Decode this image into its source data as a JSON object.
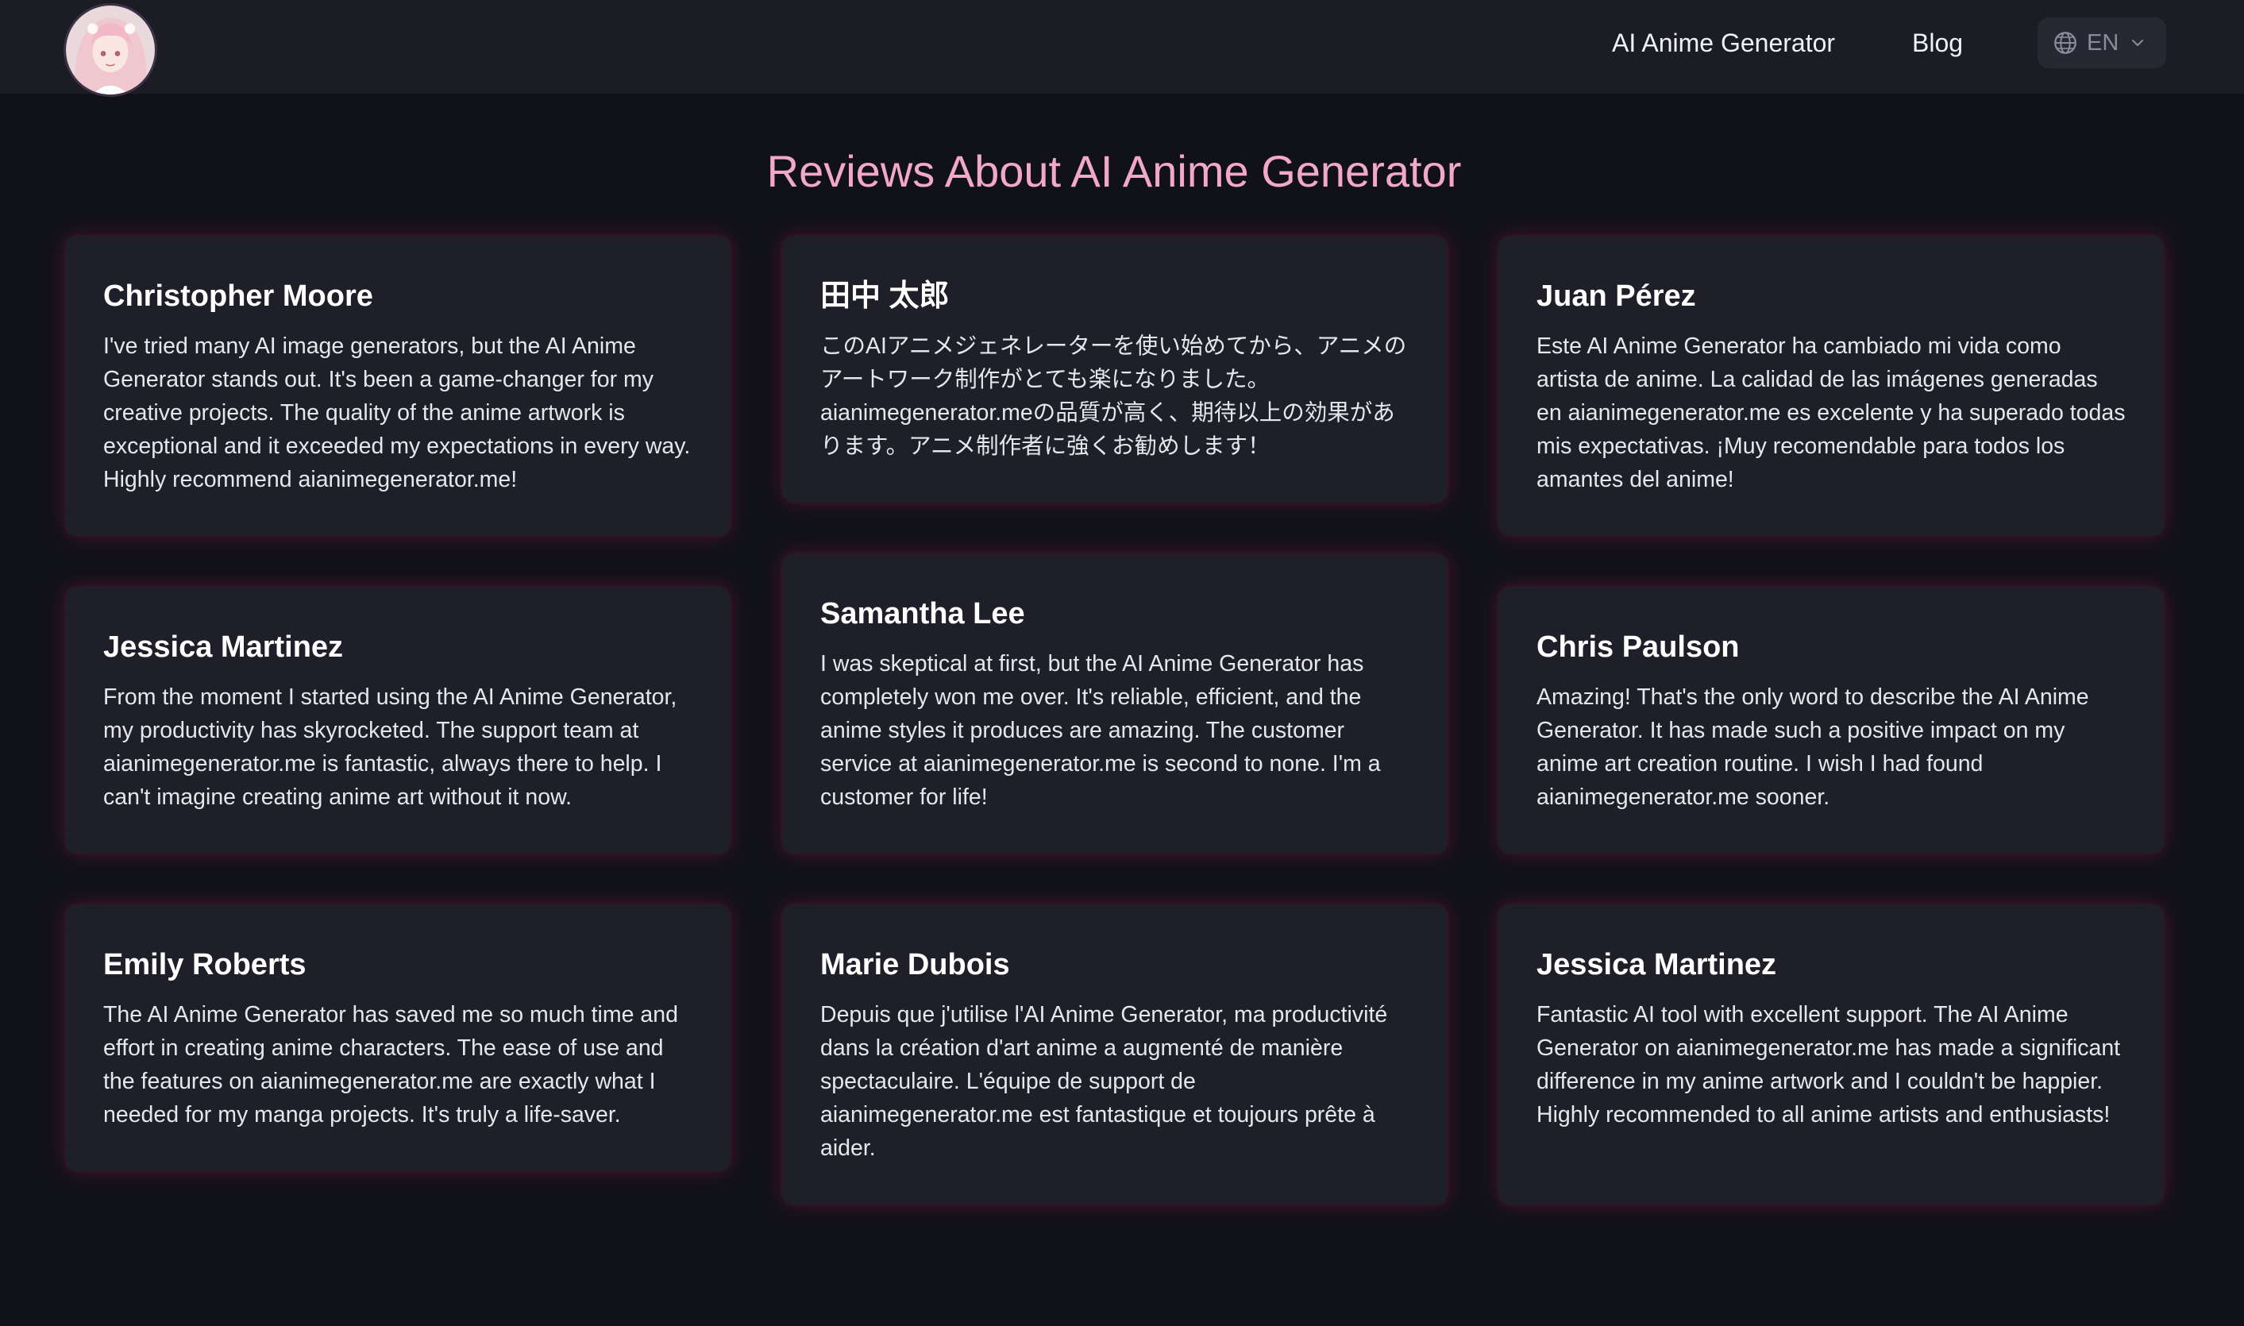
{
  "nav": {
    "links": [
      "AI Anime Generator",
      "Blog"
    ],
    "language": "EN"
  },
  "reviews_section": {
    "title": "Reviews About AI Anime Generator",
    "reviews": [
      {
        "name": "Christopher Moore",
        "text": "I've tried many AI image generators, but the AI Anime Generator stands out. It's been a game-changer for my creative projects. The quality of the anime artwork is exceptional and it exceeded my expectations in every way. Highly recommend aianimegenerator.me!"
      },
      {
        "name": "田中 太郎",
        "text": "このAIアニメジェネレーターを使い始めてから、アニメのアートワーク制作がとても楽になりました。aianimegenerator.meの品質が高く、期待以上の効果があります。アニメ制作者に強くお勧めします！"
      },
      {
        "name": "Juan Pérez",
        "text": "Este AI Anime Generator ha cambiado mi vida como artista de anime. La calidad de las imágenes generadas en aianimegenerator.me es excelente y ha superado todas mis expectativas. ¡Muy recomendable para todos los amantes del anime!"
      },
      {
        "name": "Jessica Martinez",
        "text": "From the moment I started using the AI Anime Generator, my productivity has skyrocketed. The support team at aianimegenerator.me is fantastic, always there to help. I can't imagine creating anime art without it now."
      },
      {
        "name": "Samantha Lee",
        "text": "I was skeptical at first, but the AI Anime Generator has completely won me over. It's reliable, efficient, and the anime styles it produces are amazing. The customer service at aianimegenerator.me is second to none. I'm a customer for life!"
      },
      {
        "name": "Chris Paulson",
        "text": "Amazing! That's the only word to describe the AI Anime Generator. It has made such a positive impact on my anime art creation routine. I wish I had found aianimegenerator.me sooner."
      },
      {
        "name": "Emily Roberts",
        "text": "The AI Anime Generator has saved me so much time and effort in creating anime characters. The ease of use and the features on aianimegenerator.me are exactly what I needed for my manga projects. It's truly a life-saver."
      },
      {
        "name": "Marie Dubois",
        "text": "Depuis que j'utilise l'AI Anime Generator, ma productivité dans la création d'art anime a augmenté de manière spectaculaire. L'équipe de support de aianimegenerator.me est fantastique et toujours prête à aider."
      },
      {
        "name": "Jessica Martinez",
        "text": "Fantastic AI tool with excellent support. The AI Anime Generator on aianimegenerator.me has made a significant difference in my anime artwork and I couldn't be happier. Highly recommended to all anime artists and enthusiasts!"
      }
    ]
  }
}
